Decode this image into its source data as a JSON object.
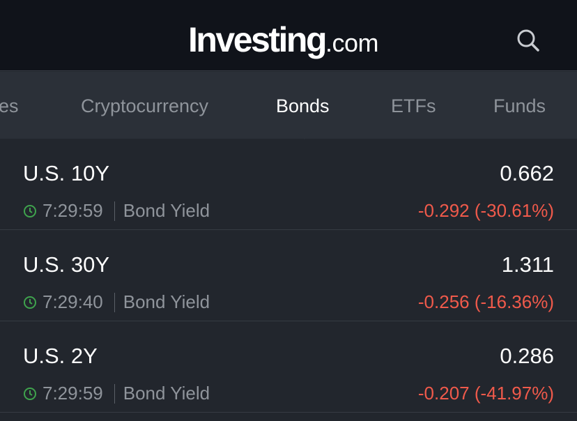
{
  "header": {
    "logo_main": "Investing",
    "logo_suffix": ".com",
    "search_icon": "search-icon"
  },
  "tabs": [
    {
      "label": "Commodities",
      "visible_text": "es",
      "active": false
    },
    {
      "label": "Cryptocurrency",
      "visible_text": "Cryptocurrency",
      "active": false
    },
    {
      "label": "Bonds",
      "visible_text": "Bonds",
      "active": true
    },
    {
      "label": "ETFs",
      "visible_text": "ETFs",
      "active": false
    },
    {
      "label": "Funds",
      "visible_text": "Funds",
      "active": false
    }
  ],
  "colors": {
    "header_bg": "#10131a",
    "tab_bg": "#2b3038",
    "list_bg": "#22262d",
    "negative": "#f05a4b",
    "clock": "#3fa34d"
  },
  "bonds": [
    {
      "name": "U.S. 10Y",
      "price": "0.662",
      "time": "7:29:59",
      "type": "Bond Yield",
      "change": "-0.292 (-30.61%)"
    },
    {
      "name": "U.S. 30Y",
      "price": "1.311",
      "time": "7:29:40",
      "type": "Bond Yield",
      "change": "-0.256 (-16.36%)"
    },
    {
      "name": "U.S. 2Y",
      "price": "0.286",
      "time": "7:29:59",
      "type": "Bond Yield",
      "change": "-0.207 (-41.97%)"
    }
  ]
}
